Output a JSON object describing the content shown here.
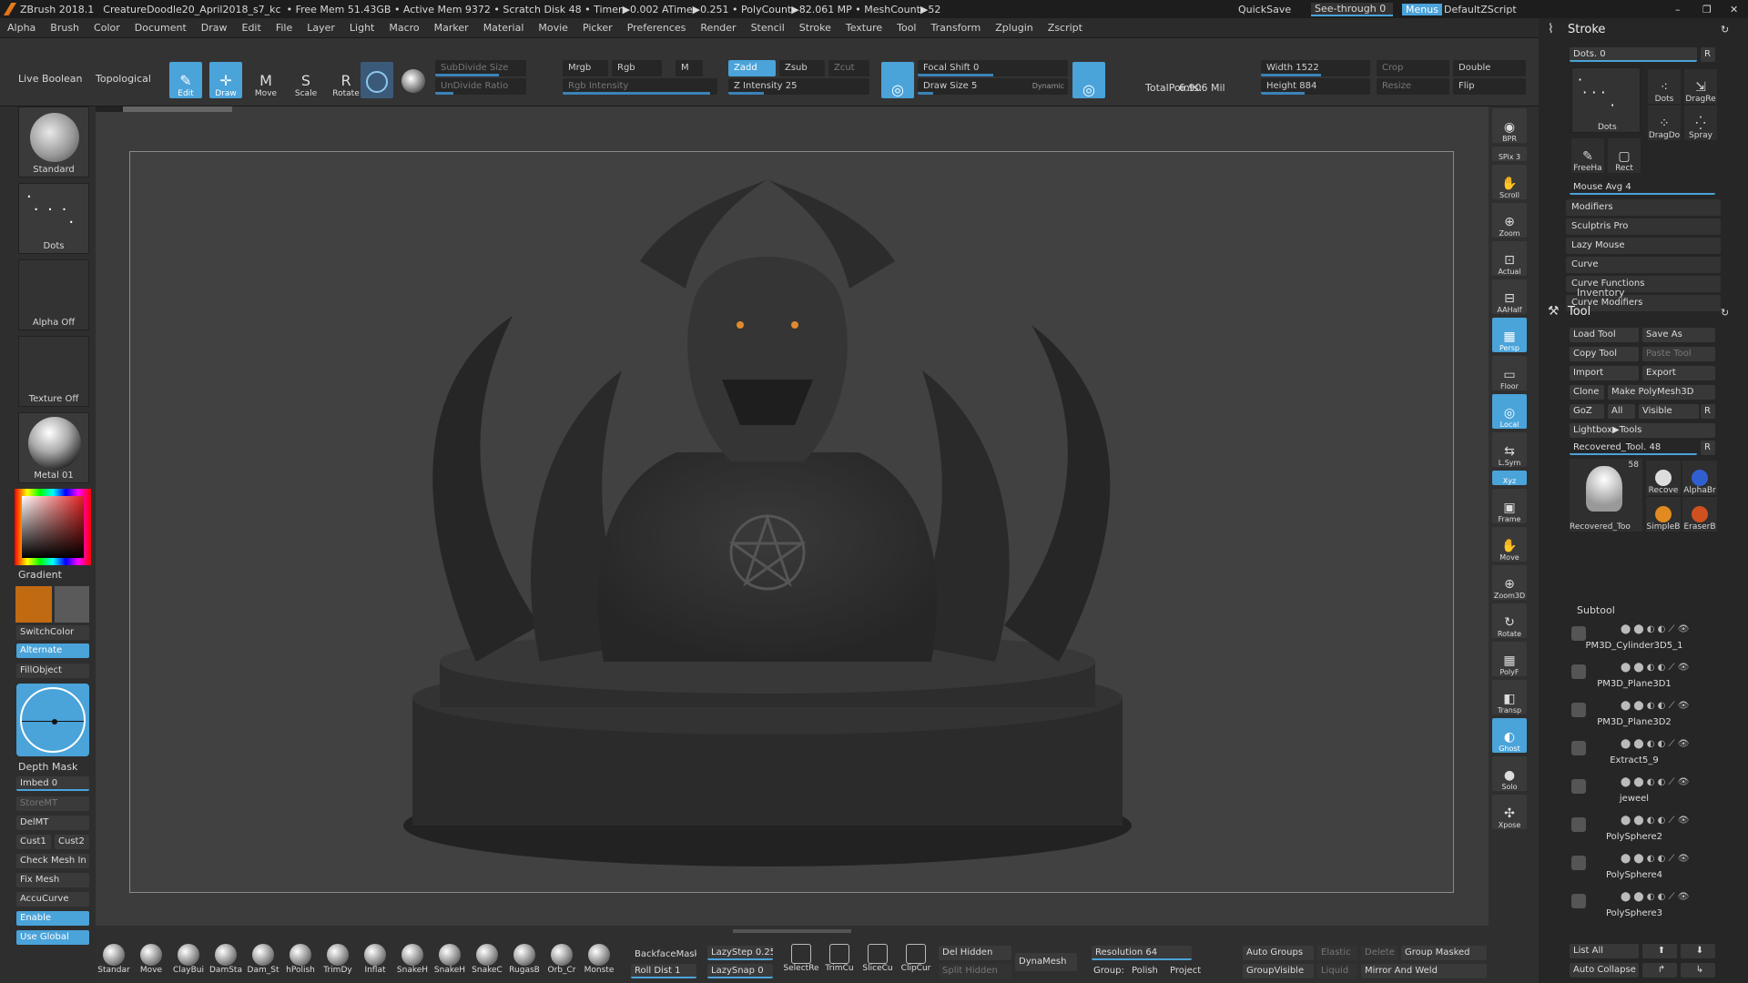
{
  "titlebar": {
    "app": "ZBrush 2018.1",
    "doc": "CreatureDoodle20_April2018_s7_kc",
    "stats": "• Free Mem 51.43GB • Active Mem 9372 • Scratch Disk 48 • Timer▶0.002 ATime▶0.251 • PolyCount▶82.061 MP • MeshCount▶52",
    "quicksave": "QuickSave",
    "see_through": "See-through  0",
    "menus": "Menus",
    "default_zscript": "DefaultZScript"
  },
  "menubar": [
    "Alpha",
    "Brush",
    "Color",
    "Document",
    "Draw",
    "Edit",
    "File",
    "Layer",
    "Light",
    "Macro",
    "Marker",
    "Material",
    "Movie",
    "Picker",
    "Preferences",
    "Render",
    "Stencil",
    "Stroke",
    "Texture",
    "Tool",
    "Transform",
    "Zplugin",
    "Zscript"
  ],
  "topshelf": {
    "live_boolean": "Live Boolean",
    "topological": "Topological",
    "tools": [
      {
        "label": "Edit",
        "icon": "✎",
        "active": true
      },
      {
        "label": "Draw",
        "icon": "✛",
        "active": true
      },
      {
        "label": "Move",
        "icon": "M",
        "active": false
      },
      {
        "label": "Scale",
        "icon": "S",
        "active": false
      },
      {
        "label": "Rotate",
        "icon": "R",
        "active": false
      }
    ],
    "subdivide_size": "SubDivide Size",
    "undivide_ratio": "UnDivide Ratio",
    "mrgb": "Mrgb",
    "rgb": "Rgb",
    "m": "M",
    "rgb_intensity": "Rgb Intensity",
    "zadd": "Zadd",
    "zsub": "Zsub",
    "zcut": "Zcut",
    "z_intensity": "Z Intensity 25",
    "z_intensity_value": 25,
    "focal_shift": "Focal Shift 0",
    "draw_size": "Draw Size 5",
    "dynamic": "Dynamic",
    "total_points_label": "TotalPoints:",
    "total_points": "6.906 Mil",
    "width": "Width 1522",
    "height": "Height 884",
    "crop": "Crop",
    "resize": "Resize",
    "double": "Double",
    "flip": "Flip"
  },
  "leftshelf": {
    "brush": "Standard",
    "stroke": "Dots",
    "alpha": "Alpha Off",
    "texture": "Texture Off",
    "material": "Metal 01",
    "gradient": "Gradient",
    "switch_color": "SwitchColor",
    "alternate": "Alternate",
    "fill_object": "FillObject",
    "depth_mask": "Depth Mask",
    "imbed": "Imbed 0",
    "store_mt": "StoreMT",
    "del_mt": "DelMT",
    "cust1": "Cust1",
    "cust2": "Cust2",
    "check_mesh": "Check Mesh In",
    "fix_mesh": "Fix Mesh",
    "accucurve": "AccuCurve",
    "enable": "Enable",
    "use_global": "Use Global",
    "main_color": "#c06a12",
    "secondary_color": "#5a5a5a"
  },
  "rightshelf": [
    {
      "label": "BPR",
      "icon": "◉",
      "blue": false
    },
    {
      "label": "SPix 3",
      "icon": "",
      "blue": false
    },
    {
      "label": "Scroll",
      "icon": "✋",
      "blue": false
    },
    {
      "label": "Zoom",
      "icon": "⊕",
      "blue": false
    },
    {
      "label": "Actual",
      "icon": "⊡",
      "blue": false
    },
    {
      "label": "AAHalf",
      "icon": "⊟",
      "blue": false
    },
    {
      "label": "Persp",
      "icon": "▦",
      "blue": true
    },
    {
      "label": "Floor",
      "icon": "▭",
      "blue": false
    },
    {
      "label": "Local",
      "icon": "◎",
      "blue": true
    },
    {
      "label": "L.Sym",
      "icon": "⇆",
      "blue": false
    },
    {
      "label": "Xyz",
      "icon": "",
      "blue": true
    },
    {
      "label": "Frame",
      "icon": "▣",
      "blue": false
    },
    {
      "label": "Move",
      "icon": "✋",
      "blue": false
    },
    {
      "label": "Zoom3D",
      "icon": "⊕",
      "blue": false
    },
    {
      "label": "Rotate",
      "icon": "↻",
      "blue": false
    },
    {
      "label": "PolyF",
      "icon": "▦",
      "blue": false
    },
    {
      "label": "Transp",
      "icon": "◧",
      "blue": false
    },
    {
      "label": "Ghost",
      "icon": "◐",
      "blue": true
    },
    {
      "label": "Solo",
      "icon": "●",
      "blue": false
    },
    {
      "label": "Xpose",
      "icon": "✣",
      "blue": false
    }
  ],
  "bottomshelf": {
    "brushes": [
      "Standar",
      "Move",
      "ClayBui",
      "DamSta",
      "Dam_St",
      "hPolish",
      "TrimDy",
      "Inflat",
      "SnakeH",
      "SnakeH",
      "SnakeC",
      "RugasB",
      "Orb_Cr",
      "Monste"
    ],
    "backface_mask": "BackfaceMask",
    "lazystep": "LazyStep 0.25",
    "roll_dist": "Roll Dist 1",
    "lazysnap": "LazySnap 0",
    "tools2": [
      "SelectRe",
      "TrimCu",
      "SliceCu",
      "ClipCur"
    ],
    "del_hidden": "Del Hidden",
    "split_hidden": "Split Hidden",
    "dynamesh": "DynaMesh",
    "resolution": "Resolution 64",
    "group": "Group:",
    "polish": "Polish",
    "project": "Project",
    "auto_groups": "Auto Groups",
    "elastic": "Elastic",
    "delete": "Delete",
    "group_masked": "Group Masked",
    "group_visible": "GroupVisible",
    "liquid": "Liquid",
    "mirror_and_weld": "Mirror And Weld"
  },
  "panel": {
    "stroke_title": "Stroke",
    "dots_label": "Dots. 0",
    "r": "R",
    "stroke_types": [
      "Dots",
      "DragRe",
      "DragDo",
      "Spray",
      "FreeHa",
      "Rect"
    ],
    "dots_big": "Dots",
    "mouse_avg": "Mouse Avg 4",
    "stroke_menu": [
      "Modifiers",
      "Sculptris Pro",
      "Lazy Mouse",
      "Curve",
      "Curve Functions",
      "Curve Modifiers"
    ],
    "inventory": "Inventory",
    "tool_title": "Tool",
    "load_tool": "Load Tool",
    "save_as": "Save As",
    "copy_tool": "Copy Tool",
    "paste_tool": "Paste Tool",
    "import": "Import",
    "export": "Export",
    "clone": "Clone",
    "make_polymesh": "Make PolyMesh3D",
    "goz": "GoZ",
    "all": "All",
    "visible": "Visible",
    "lightbox_tools": "Lightbox▶Tools",
    "recovered_tool": "Recovered_Tool. 48",
    "tool_thumbs": [
      "Recovered_Too",
      "Recove",
      "AlphaBr",
      "SimpleB",
      "EraserB"
    ],
    "tool_count": "58",
    "subtool_title": "Subtool",
    "subtools": [
      "PM3D_Cylinder3D5_1",
      "PM3D_Plane3D1",
      "PM3D_Plane3D2",
      "Extract5_9",
      "jeweel",
      "PolySphere2",
      "PolySphere4",
      "PolySphere3"
    ],
    "list_all": "List All",
    "auto_collapse": "Auto Collapse"
  }
}
